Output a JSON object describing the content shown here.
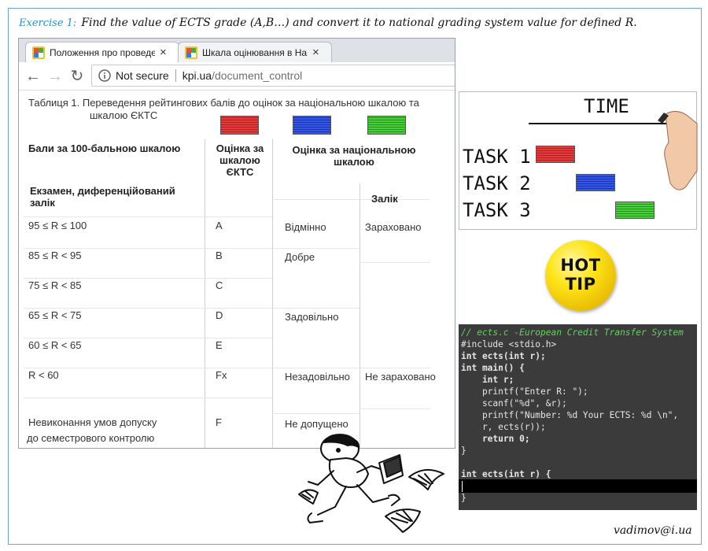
{
  "exercise": {
    "label": "Exercise 1:",
    "text": "Find the value of ECTS grade (A,B…) and convert it to national grading system value  for defined R."
  },
  "browser": {
    "tabs": [
      {
        "title": "Положення про проведенн",
        "close": "×"
      },
      {
        "title": "Шкала оцінювання в Наці",
        "close": "×"
      }
    ],
    "address": {
      "security": "Not secure",
      "host": "kpi.ua",
      "path": "/document_control"
    },
    "nav": {
      "back": "←",
      "forward": "→",
      "reload": "↻"
    }
  },
  "table": {
    "caption_line1": "Таблиця 1. Переведення рейтингових балів до оцінок за національною шкалою та",
    "caption_line2": "шкалою ЄКТС",
    "headers": {
      "score": "Бали за 100-бальною шкалою",
      "ects": "Оцінка за шкалою ЄКТС",
      "national": "Оцінка за національною шкалою",
      "exam": "Екзамен, диференційований залік",
      "credit": "Залік"
    },
    "rows": [
      {
        "score": "95 ≤ R ≤ 100",
        "ects": "A",
        "exam": "Відмінно",
        "credit": "Зараховано"
      },
      {
        "score": "85 ≤ R < 95",
        "ects": "B",
        "exam": "Добре",
        "credit": ""
      },
      {
        "score": "75 ≤ R < 85",
        "ects": "C",
        "exam": "",
        "credit": ""
      },
      {
        "score": "65 ≤ R < 75",
        "ects": "D",
        "exam": "Задовільно",
        "credit": ""
      },
      {
        "score": "60 ≤ R < 65",
        "ects": "E",
        "exam": "",
        "credit": ""
      },
      {
        "score": "R < 60",
        "ects": "Fx",
        "exam": "Незадовільно",
        "credit": "Не зараховано"
      },
      {
        "score_line1": "Невиконання умов допуску",
        "score_line2": "до семестрового контролю",
        "ects": "F",
        "exam": "Не допущено",
        "credit": ""
      }
    ],
    "swatch_colors": [
      "#d62b2b",
      "#2a45d6",
      "#3cc135"
    ]
  },
  "time_panel": {
    "title": "TIME",
    "tasks": [
      {
        "label": "TASK 1",
        "color": "#d62b2b"
      },
      {
        "label": "TASK 2",
        "color": "#2a45d6"
      },
      {
        "label": "TASK 3",
        "color": "#3cc135"
      }
    ]
  },
  "hot_tip": {
    "line1": "HOT",
    "line2": "TIP"
  },
  "code": {
    "lines": [
      "// ects.c -European Credit Transfer System",
      "#include <stdio.h>",
      "int ects(int r);",
      "int main() {",
      "    int r;",
      "    printf(\"Enter R: \");",
      "    scanf(\"%d\", &r);",
      "    printf(\"Number: %d Your ECTS: %d \\n\",",
      "    r, ects(r));",
      "    return 0;",
      "}",
      "",
      "int ects(int r) {",
      "",
      "}"
    ]
  },
  "footer": {
    "email": "vadimov@i.ua"
  }
}
